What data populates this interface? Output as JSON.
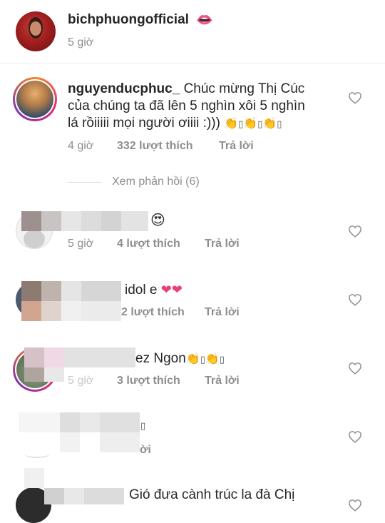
{
  "post": {
    "username": "bichphuongofficial",
    "time": "5 giờ",
    "lips_emoji": "👄"
  },
  "comments": [
    {
      "username": "nguyenducphuc_",
      "text_line1": "Chúc mừng Thị Cúc",
      "text_line2": "của chúng ta đã lên 5 nghìn xôi 5 nghìn",
      "text_line3": "lá rồiiiii mọi người ơiiii :)))",
      "time": "4 giờ",
      "likes": "332 lượt thích",
      "reply": "Trả lời",
      "view_replies": "Xem phản hồi (6)"
    },
    {
      "emoji": "😍",
      "time": "5 giờ",
      "likes": "4 lượt thích",
      "reply": "Trả lời"
    },
    {
      "text": "idol e",
      "likes": "2 lượt thích",
      "reply": "Trả lời"
    },
    {
      "text": "ez Ngon",
      "likes": "3 lượt thích",
      "time": "5 giờ",
      "reply": "Trả lời"
    },
    {
      "reply_partial": "ời"
    },
    {
      "text": "Gió đưa cành trúc la đà  Chị"
    }
  ],
  "colors": {
    "text": "#262626",
    "meta": "#8e8e8e",
    "heart_outline": "#8e8e8e",
    "clap_emoji": "#9b7ad9",
    "heart_emoji": "#e8407e"
  }
}
